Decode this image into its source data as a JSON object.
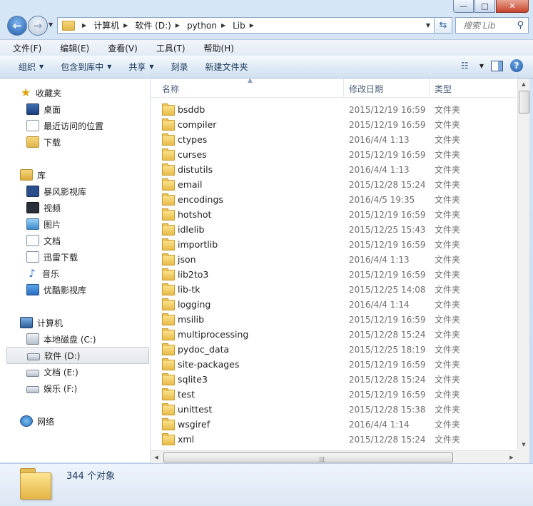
{
  "window": {
    "controls": {
      "minimize": "—",
      "maximize": "□",
      "close": "✕"
    }
  },
  "address": {
    "crumbs": [
      "计算机",
      "软件 (D:)",
      "python",
      "Lib"
    ],
    "search_placeholder": "搜索 Lib"
  },
  "menu": [
    "文件(F)",
    "编辑(E)",
    "查看(V)",
    "工具(T)",
    "帮助(H)"
  ],
  "commands": [
    "组织",
    "包含到库中",
    "共享",
    "刻录",
    "新建文件夹"
  ],
  "nav": {
    "favorites": {
      "label": "收藏夹",
      "items": [
        "桌面",
        "最近访问的位置",
        "下载"
      ]
    },
    "libraries": {
      "label": "库",
      "items": [
        "暴风影视库",
        "视频",
        "图片",
        "文档",
        "迅雷下载",
        "音乐",
        "优酷影视库"
      ]
    },
    "computer": {
      "label": "计算机",
      "items": [
        "本地磁盘 (C:)",
        "软件 (D:)",
        "文档 (E:)",
        "娱乐 (F:)"
      ]
    },
    "network": {
      "label": "网络"
    }
  },
  "columns": {
    "name": "名称",
    "date": "修改日期",
    "type": "类型"
  },
  "files": [
    {
      "name": "bsddb",
      "date": "2015/12/19 16:59",
      "type": "文件夹"
    },
    {
      "name": "compiler",
      "date": "2015/12/19 16:59",
      "type": "文件夹"
    },
    {
      "name": "ctypes",
      "date": "2016/4/4 1:13",
      "type": "文件夹"
    },
    {
      "name": "curses",
      "date": "2015/12/19 16:59",
      "type": "文件夹"
    },
    {
      "name": "distutils",
      "date": "2016/4/4 1:13",
      "type": "文件夹"
    },
    {
      "name": "email",
      "date": "2015/12/28 15:24",
      "type": "文件夹"
    },
    {
      "name": "encodings",
      "date": "2016/4/5 19:35",
      "type": "文件夹"
    },
    {
      "name": "hotshot",
      "date": "2015/12/19 16:59",
      "type": "文件夹"
    },
    {
      "name": "idlelib",
      "date": "2015/12/25 15:43",
      "type": "文件夹"
    },
    {
      "name": "importlib",
      "date": "2015/12/19 16:59",
      "type": "文件夹"
    },
    {
      "name": "json",
      "date": "2016/4/4 1:13",
      "type": "文件夹"
    },
    {
      "name": "lib2to3",
      "date": "2015/12/19 16:59",
      "type": "文件夹"
    },
    {
      "name": "lib-tk",
      "date": "2015/12/25 14:08",
      "type": "文件夹"
    },
    {
      "name": "logging",
      "date": "2016/4/4 1:14",
      "type": "文件夹"
    },
    {
      "name": "msilib",
      "date": "2015/12/19 16:59",
      "type": "文件夹"
    },
    {
      "name": "multiprocessing",
      "date": "2015/12/28 15:24",
      "type": "文件夹"
    },
    {
      "name": "pydoc_data",
      "date": "2015/12/25 18:19",
      "type": "文件夹"
    },
    {
      "name": "site-packages",
      "date": "2015/12/19 16:59",
      "type": "文件夹"
    },
    {
      "name": "sqlite3",
      "date": "2015/12/28 15:24",
      "type": "文件夹"
    },
    {
      "name": "test",
      "date": "2015/12/19 16:59",
      "type": "文件夹"
    },
    {
      "name": "unittest",
      "date": "2015/12/28 15:38",
      "type": "文件夹"
    },
    {
      "name": "wsgiref",
      "date": "2016/4/4 1:14",
      "type": "文件夹"
    },
    {
      "name": "xml",
      "date": "2015/12/28 15:24",
      "type": "文件夹"
    }
  ],
  "status": {
    "count": "344 个对象"
  },
  "icons": {
    "favorites": "star-icon",
    "desktop": "desktop-icon",
    "recent": "recent-places-icon",
    "downloads": "downloads-icon",
    "library": "library-icon",
    "folder": "folder-icon",
    "drive": "drive-icon",
    "network": "network-icon",
    "help": "help-icon"
  }
}
